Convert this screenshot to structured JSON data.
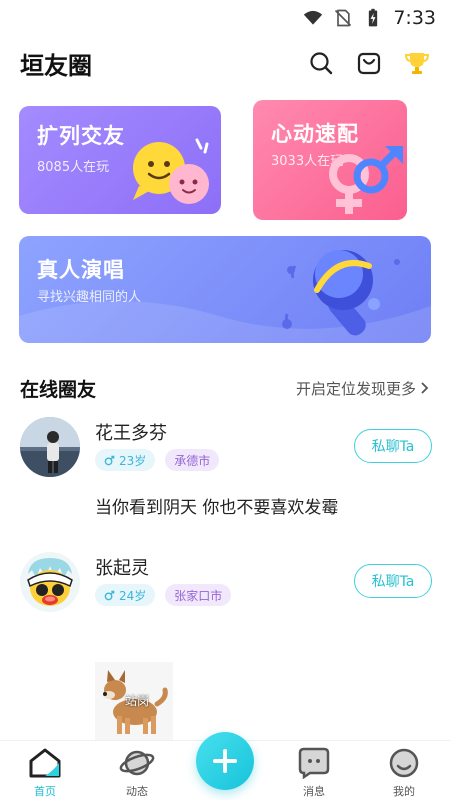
{
  "status_bar": {
    "time": "7:33"
  },
  "header": {
    "title": "垣友圈"
  },
  "cards": {
    "expand": {
      "title": "扩列交友",
      "subtitle": "8085人在玩"
    },
    "match": {
      "title": "心动速配",
      "subtitle": "3033人在玩"
    },
    "sing": {
      "title": "真人演唱",
      "subtitle": "寻找兴趣相同的人"
    }
  },
  "online_section": {
    "title": "在线圈友",
    "link_label": "开启定位发现更多"
  },
  "users": [
    {
      "name": "花王多芬",
      "age": "23岁",
      "city": "承德市",
      "chat_label": "私聊Ta",
      "post": "当你看到阴天 你也不要喜欢发霉"
    },
    {
      "name": "张起灵",
      "age": "24岁",
      "city": "张家口市",
      "chat_label": "私聊Ta",
      "post": ""
    }
  ],
  "photo_overlay_text": "站岗",
  "bottom_nav": [
    {
      "label": "首页",
      "icon": "home-icon",
      "active": true
    },
    {
      "label": "动态",
      "icon": "planet-icon",
      "active": false
    },
    {
      "label": "消息",
      "icon": "message-icon",
      "active": false
    },
    {
      "label": "我的",
      "icon": "profile-icon",
      "active": false
    }
  ],
  "colors": {
    "accent": "#1fbfd0",
    "card_purple": "#8d6ff7",
    "card_pink": "#fb5f8f",
    "card_blue": "#6f7ff5"
  }
}
